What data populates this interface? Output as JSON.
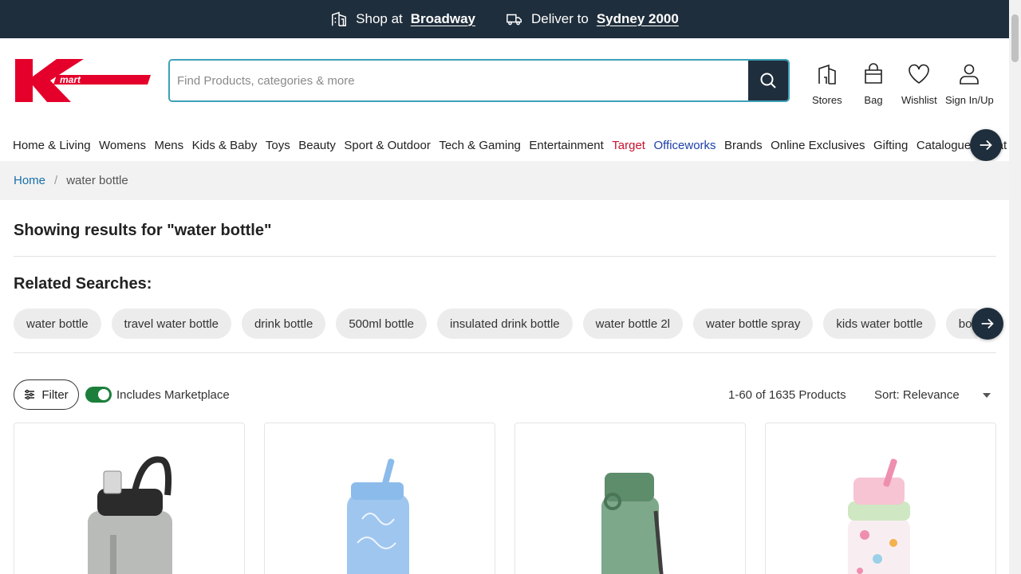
{
  "topbar": {
    "shop_prefix": "Shop at",
    "shop_store": "Broadway",
    "deliver_prefix": "Deliver to",
    "deliver_location": "Sydney 2000"
  },
  "brand": {
    "logo_text": "Kmart",
    "logo_color": "#e4002b"
  },
  "search": {
    "placeholder": "Find Products, categories & more",
    "value": ""
  },
  "header_icons": {
    "stores": "Stores",
    "bag": "Bag",
    "wishlist": "Wishlist",
    "signin": "Sign In/Up"
  },
  "nav": {
    "items": [
      "Home & Living",
      "Womens",
      "Mens",
      "Kids & Baby",
      "Toys",
      "Beauty",
      "Sport & Outdoor",
      "Tech & Gaming",
      "Entertainment",
      "Target",
      "Officeworks",
      "Brands",
      "Online Exclusives",
      "Gifting",
      "Catalogue",
      "Treat"
    ]
  },
  "breadcrumb": {
    "home": "Home",
    "separator": "/",
    "current": "water bottle"
  },
  "results": {
    "title": "Showing results for \"water bottle\""
  },
  "related": {
    "title": "Related Searches:",
    "chips": [
      "water bottle",
      "travel water bottle",
      "drink bottle",
      "500ml bottle",
      "insulated drink bottle",
      "water bottle 2l",
      "water bottle spray",
      "kids water bottle",
      "bottle"
    ]
  },
  "toolbar": {
    "filter_label": "Filter",
    "marketplace_label": "Includes Marketplace",
    "marketplace_on": true,
    "count_text": "1-60 of 1635 Products",
    "sort_label": "Sort: Relevance"
  },
  "colors": {
    "dark": "#1f2e3c",
    "accent": "#3da0b8",
    "toggle_on": "#1b7f3b",
    "target": "#c8102e",
    "officeworks": "#1c3fa8"
  }
}
